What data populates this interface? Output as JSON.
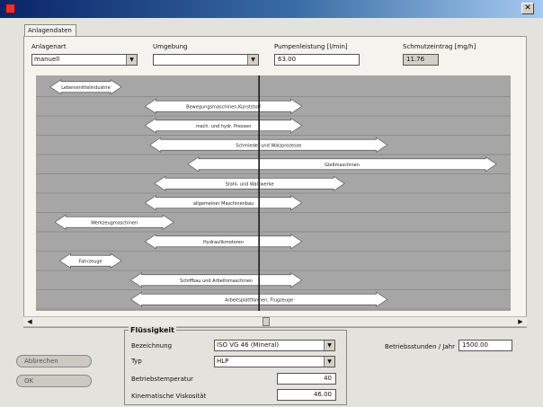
{
  "tab_label": "Anlagendaten",
  "top": {
    "anlagenart_label": "Anlagenart",
    "anlagenart_value": "manuell",
    "umgebung_label": "Umgebung",
    "umgebung_value": "",
    "pumpen_label": "Pumpenleistung [l/min]",
    "pumpen_value": "63.00",
    "schmutz_label": "Schmutzeintrag [mg/h]",
    "schmutz_value": "11.76"
  },
  "chart_data": {
    "type": "range-bars",
    "marker_fraction": 0.47,
    "rows": [
      {
        "label": "Lebensmittelindustrie",
        "start": 0.03,
        "end": 0.18
      },
      {
        "label": "Bewegungsmaschinen,Kunststoff",
        "start": 0.23,
        "end": 0.56
      },
      {
        "label": "mech. und hydr. Pressen",
        "start": 0.23,
        "end": 0.56
      },
      {
        "label": "Schmiede- und Walzprozesse",
        "start": 0.24,
        "end": 0.74
      },
      {
        "label": "Gießmaschinen",
        "start": 0.32,
        "end": 0.97
      },
      {
        "label": "Stahl- und Walzwerke",
        "start": 0.25,
        "end": 0.65
      },
      {
        "label": "allgemeiner Maschinenbau",
        "start": 0.23,
        "end": 0.56
      },
      {
        "label": "Werkzeugmaschinen",
        "start": 0.04,
        "end": 0.29
      },
      {
        "label": "Hydraulikmotoren",
        "start": 0.23,
        "end": 0.56
      },
      {
        "label": "Fahrzeuge",
        "start": 0.05,
        "end": 0.18
      },
      {
        "label": "Schiffbau und Arbeitsmaschinen",
        "start": 0.2,
        "end": 0.56
      },
      {
        "label": "Arbeitsplattformen, Flugzeuge",
        "start": 0.2,
        "end": 0.74
      }
    ]
  },
  "fluid": {
    "title": "Flüssigkeit",
    "bezeichnung_label": "Bezeichnung",
    "bezeichnung_value": "ISO VG 46 (Mineral)",
    "typ_label": "Typ",
    "typ_value": "HLP",
    "temp_label": "Betriebstemperatur",
    "temp_value": "40",
    "visk_label": "Kinematische Viskosität",
    "visk_value": "46.00"
  },
  "betrieb_label": "Betriebsstunden / Jahr",
  "betrieb_value": "1500.00",
  "buttons": {
    "abbrechen": "Abbrechen",
    "ok": "OK"
  },
  "colors": {
    "chart_bg": "#a6a6a6",
    "row_line": "#8e8e8e",
    "arrow_fill": "#ffffff",
    "marker": "#1a1a1a"
  }
}
